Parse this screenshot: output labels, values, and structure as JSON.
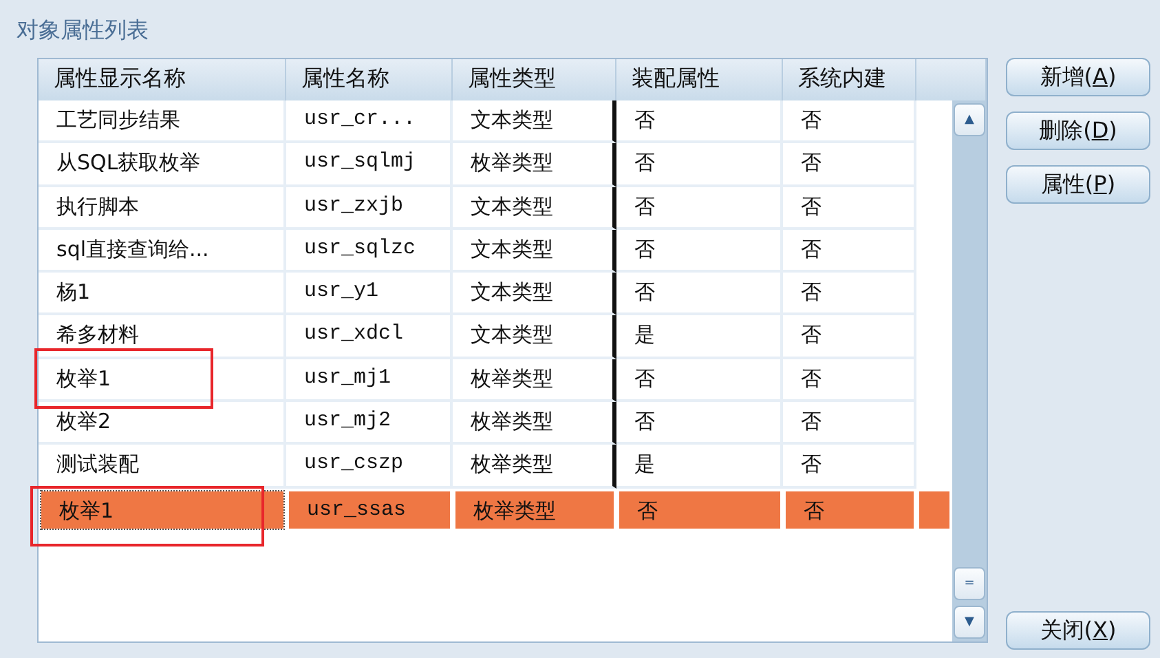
{
  "title": "对象属性列表",
  "table": {
    "columns": [
      "属性显示名称",
      "属性名称",
      "属性类型",
      "装配属性",
      "系统内建"
    ],
    "rows": [
      {
        "cells": [
          "工艺同步结果",
          "usr_cr...",
          "文本类型",
          "否",
          "否"
        ],
        "selected": false,
        "annotated": false
      },
      {
        "cells": [
          "从SQL获取枚举",
          "usr_sqlmj",
          "枚举类型",
          "否",
          "否"
        ],
        "selected": false,
        "annotated": false
      },
      {
        "cells": [
          "执行脚本",
          "usr_zxjb",
          "文本类型",
          "否",
          "否"
        ],
        "selected": false,
        "annotated": false
      },
      {
        "cells": [
          "sql直接查询给...",
          "usr_sqlzc",
          "文本类型",
          "否",
          "否"
        ],
        "selected": false,
        "annotated": false
      },
      {
        "cells": [
          "杨1",
          "usr_y1",
          "文本类型",
          "否",
          "否"
        ],
        "selected": false,
        "annotated": false
      },
      {
        "cells": [
          "希多材料",
          "usr_xdcl",
          "文本类型",
          "是",
          "否"
        ],
        "selected": false,
        "annotated": false
      },
      {
        "cells": [
          "枚举1",
          "usr_mj1",
          "枚举类型",
          "否",
          "否"
        ],
        "selected": false,
        "annotated": true
      },
      {
        "cells": [
          "枚举2",
          "usr_mj2",
          "枚举类型",
          "否",
          "否"
        ],
        "selected": false,
        "annotated": false
      },
      {
        "cells": [
          "测试装配",
          "usr_cszp",
          "枚举类型",
          "是",
          "否"
        ],
        "selected": false,
        "annotated": false
      },
      {
        "cells": [
          "枚举1",
          "usr_ssas",
          "枚举类型",
          "否",
          "否"
        ],
        "selected": true,
        "annotated": true
      }
    ]
  },
  "scrollbar": {
    "up": "▲",
    "grip": "=",
    "down": "▼"
  },
  "buttons": [
    {
      "before": "新增(",
      "key": "A",
      "after": ")",
      "kind": "top"
    },
    {
      "before": "删除(",
      "key": "D",
      "after": ")",
      "kind": "top"
    },
    {
      "before": "属性(",
      "key": "P",
      "after": ")",
      "kind": "top"
    },
    {
      "before": "关闭(",
      "key": "X",
      "after": ")",
      "kind": "bottom"
    }
  ]
}
